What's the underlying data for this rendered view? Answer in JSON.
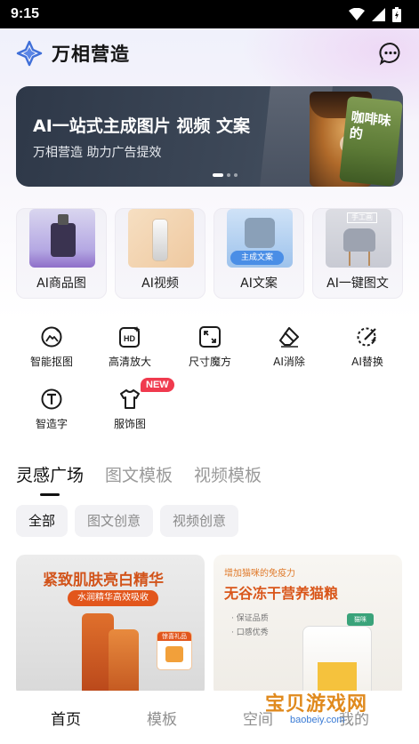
{
  "status_bar": {
    "time": "9:15"
  },
  "header": {
    "app_title": "万相营造",
    "logo_icon": "wanxiang-logo-icon",
    "message_icon": "chat-bubble-icon"
  },
  "banner": {
    "title": "AI一站式主成图片 视频 文案",
    "subtitle": "万相营造 助力广告提效",
    "card_text": "咖啡味的",
    "page_count": 3,
    "active_page": 1
  },
  "features": [
    {
      "label": "AI商品图",
      "thumb": "perfume"
    },
    {
      "label": "AI视频",
      "thumb": "bottle"
    },
    {
      "label": "AI文案",
      "thumb": "cat",
      "tag": "主成文案"
    },
    {
      "label": "AI一键图文",
      "thumb": "chair",
      "tag": "手工画"
    }
  ],
  "tools": [
    {
      "label": "智能抠图",
      "icon": "smart-cutout-icon"
    },
    {
      "label": "高清放大",
      "icon": "hd-upscale-icon"
    },
    {
      "label": "尺寸魔方",
      "icon": "resize-icon"
    },
    {
      "label": "AI消除",
      "icon": "eraser-icon"
    },
    {
      "label": "AI替换",
      "icon": "magic-wand-icon"
    },
    {
      "label": "智造字",
      "icon": "text-t-icon"
    },
    {
      "label": "服饰图",
      "icon": "tshirt-icon",
      "badge": "NEW"
    }
  ],
  "section_tabs": [
    {
      "label": "灵感广场",
      "active": true
    },
    {
      "label": "图文模板",
      "active": false
    },
    {
      "label": "视频模板",
      "active": false
    }
  ],
  "filters": [
    {
      "label": "全部",
      "active": true
    },
    {
      "label": "图文创意",
      "active": false
    },
    {
      "label": "视频创意",
      "active": false
    }
  ],
  "cards": {
    "left": {
      "title": "紧致肌肤亮白精华",
      "pill": "水润精华高效吸收",
      "gift": "惊喜礼品"
    },
    "right": {
      "subtitle": "增加猫咪的免疫力",
      "title": "无谷冻干营养猫粮",
      "line1": "· 保证品质",
      "line2": "· 口感优秀",
      "stamp": "猫咪"
    }
  },
  "bottom_nav": [
    {
      "label": "首页",
      "active": true
    },
    {
      "label": "模板",
      "active": false
    },
    {
      "label": "空间",
      "active": false
    },
    {
      "label": "我的",
      "active": false
    }
  ],
  "watermark": {
    "main": "宝贝游戏网",
    "sub": "baobeiy.com"
  },
  "colors": {
    "accent": "#111111",
    "badge": "#f03a4e",
    "banner_bg": "#3c4757",
    "muted": "#9a9a9a"
  }
}
